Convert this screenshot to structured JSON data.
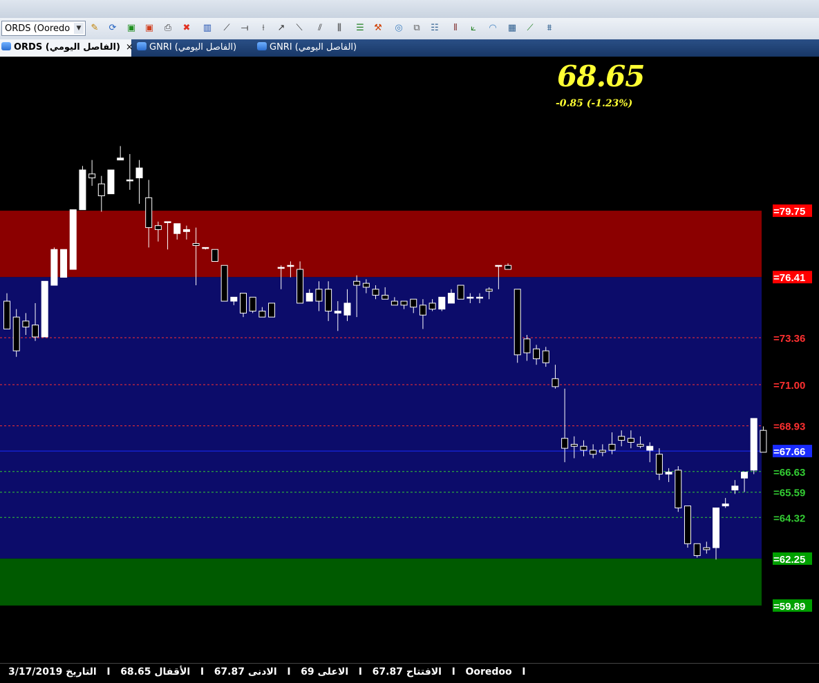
{
  "toolbar": {
    "symbol_value": "ORDS (Ooredo",
    "tools": [
      "magic-wand-icon",
      "refresh-icon",
      "add-chart-icon",
      "remove-chart-icon",
      "print-icon",
      "close-red-icon",
      "bar-chart-icon",
      "trend-tool-icon",
      "horizontal-line-icon",
      "vertical-line-icon",
      "ray-icon",
      "channel-icon",
      "parallel-icon",
      "bars-icon",
      "levels-icon",
      "tools-icon",
      "circle-icon",
      "copy-icon",
      "grid-icon",
      "stripes-icon",
      "fan-icon",
      "arc-icon",
      "table-icon",
      "speed-lines-icon",
      "pitchfork-icon"
    ]
  },
  "tabs": [
    {
      "label": "ORDS (الفاصل اليومي)",
      "close": "×",
      "active": true
    },
    {
      "label": "GNRI (الفاصل اليومي)",
      "active": false
    },
    {
      "label": "GNRI (الفاصل اليومي)",
      "active": false
    }
  ],
  "price": {
    "last": "68.65",
    "change": "-0.85  (-1.23%)"
  },
  "chart_data": {
    "type": "candlestick",
    "ylim": [
      57.0,
      87.5
    ],
    "zones": [
      {
        "from": 76.41,
        "to": 79.75,
        "color": "#8b0000"
      },
      {
        "from": 62.25,
        "to": 76.41,
        "color": "#0c0c6a"
      },
      {
        "from": 59.89,
        "to": 62.25,
        "color": "#005a00"
      }
    ],
    "levels": [
      {
        "value": 79.75,
        "label": "=79.75",
        "color": "#ff0000",
        "style": "box"
      },
      {
        "value": 76.41,
        "label": "=76.41",
        "color": "#ff0000",
        "style": "box"
      },
      {
        "value": 73.36,
        "label": "=73.36",
        "color": "#ff3030",
        "style": "dashed"
      },
      {
        "value": 71.0,
        "label": "=71.00",
        "color": "#ff3030",
        "style": "dashed"
      },
      {
        "value": 68.93,
        "label": "=68.93",
        "color": "#ff3030",
        "style": "dashed"
      },
      {
        "value": 67.66,
        "label": "=67.66",
        "color": "#1a2cff",
        "style": "solid"
      },
      {
        "value": 66.63,
        "label": "=66.63",
        "color": "#33cc33",
        "style": "dashed"
      },
      {
        "value": 65.59,
        "label": "=65.59",
        "color": "#33cc33",
        "style": "dashed"
      },
      {
        "value": 64.32,
        "label": "=64.32",
        "color": "#33cc33",
        "style": "dashed"
      },
      {
        "value": 62.25,
        "label": "=62.25",
        "color": "#00a000",
        "style": "box"
      },
      {
        "value": 59.89,
        "label": "=59.89",
        "color": "#00a000",
        "style": "box"
      }
    ],
    "candles": [
      [
        75.2,
        75.6,
        73.9,
        73.8
      ],
      [
        74.4,
        74.8,
        72.4,
        72.7
      ],
      [
        74.2,
        74.6,
        73.5,
        73.9
      ],
      [
        74.0,
        75.1,
        73.2,
        73.4
      ],
      [
        73.4,
        76.2,
        73.4,
        76.2
      ],
      [
        76.0,
        77.9,
        76.0,
        77.8
      ],
      [
        76.4,
        77.8,
        76.4,
        77.8
      ],
      [
        76.8,
        79.8,
        76.8,
        79.8
      ],
      [
        79.8,
        82.0,
        79.8,
        81.8
      ],
      [
        81.6,
        82.3,
        81.0,
        81.4
      ],
      [
        81.1,
        81.5,
        79.7,
        80.5
      ],
      [
        80.6,
        81.8,
        80.6,
        81.8
      ],
      [
        82.3,
        83.0,
        82.3,
        82.4
      ],
      [
        81.3,
        82.6,
        80.8,
        81.3
      ],
      [
        81.4,
        82.3,
        80.1,
        81.9
      ],
      [
        80.4,
        81.3,
        77.9,
        78.9
      ],
      [
        79.0,
        79.2,
        78.2,
        78.8
      ],
      [
        79.2,
        79.2,
        77.8,
        79.2
      ],
      [
        78.6,
        79.0,
        78.3,
        79.1
      ],
      [
        78.7,
        79.0,
        78.3,
        78.8
      ],
      [
        78.1,
        78.9,
        76.0,
        78.0
      ],
      [
        77.9,
        77.9,
        77.8,
        77.9
      ],
      [
        77.8,
        77.8,
        77.2,
        77.2
      ],
      [
        77.0,
        77.0,
        75.2,
        75.2
      ],
      [
        75.2,
        75.2,
        75.0,
        75.4
      ],
      [
        75.6,
        75.6,
        74.4,
        74.6
      ],
      [
        75.4,
        75.4,
        74.6,
        74.7
      ],
      [
        74.7,
        74.9,
        74.4,
        74.4
      ],
      [
        75.1,
        75.1,
        74.6,
        74.4
      ],
      [
        76.9,
        77.0,
        75.8,
        76.9
      ],
      [
        77.0,
        77.2,
        76.4,
        77.0
      ],
      [
        76.8,
        77.2,
        75.1,
        75.1
      ],
      [
        75.2,
        75.8,
        75.2,
        75.6
      ],
      [
        75.8,
        76.2,
        74.7,
        75.2
      ],
      [
        75.8,
        76.2,
        74.2,
        74.7
      ],
      [
        74.6,
        75.2,
        73.7,
        74.7
      ],
      [
        74.5,
        75.8,
        74.2,
        75.1
      ],
      [
        76.2,
        76.5,
        74.4,
        76.0
      ],
      [
        76.1,
        76.3,
        75.6,
        75.9
      ],
      [
        75.8,
        76.0,
        75.3,
        75.5
      ],
      [
        75.5,
        75.9,
        75.4,
        75.3
      ],
      [
        75.2,
        75.4,
        75.2,
        75.0
      ],
      [
        75.2,
        75.2,
        74.8,
        75.0
      ],
      [
        75.3,
        75.3,
        74.6,
        74.9
      ],
      [
        75.0,
        75.3,
        73.8,
        74.5
      ],
      [
        75.1,
        75.3,
        74.7,
        74.8
      ],
      [
        74.8,
        75.1,
        74.7,
        75.4
      ],
      [
        75.1,
        75.8,
        75.1,
        75.6
      ],
      [
        76.0,
        76.0,
        75.3,
        75.3
      ],
      [
        75.4,
        75.6,
        75.1,
        75.4
      ],
      [
        75.4,
        75.6,
        75.1,
        75.4
      ],
      [
        75.8,
        75.9,
        75.3,
        75.7
      ],
      [
        77.0,
        77.0,
        75.8,
        77.0
      ],
      [
        77.0,
        77.1,
        76.8,
        76.8
      ],
      [
        75.8,
        75.8,
        72.1,
        72.5
      ],
      [
        73.3,
        73.5,
        72.2,
        72.6
      ],
      [
        72.8,
        73.0,
        72.0,
        72.3
      ],
      [
        72.7,
        72.9,
        71.9,
        72.1
      ],
      [
        71.3,
        72.0,
        70.8,
        70.9
      ],
      [
        68.3,
        70.8,
        67.1,
        67.8
      ],
      [
        68.0,
        68.4,
        67.3,
        67.9
      ],
      [
        67.9,
        68.2,
        67.4,
        67.7
      ],
      [
        67.7,
        68.0,
        67.3,
        67.5
      ],
      [
        67.7,
        68.0,
        67.4,
        67.6
      ],
      [
        68.0,
        68.6,
        67.5,
        67.7
      ],
      [
        68.4,
        68.7,
        67.9,
        68.2
      ],
      [
        68.3,
        68.7,
        67.8,
        68.1
      ],
      [
        68.0,
        68.4,
        67.8,
        67.9
      ],
      [
        67.7,
        68.1,
        67.1,
        67.9
      ],
      [
        67.5,
        67.8,
        66.2,
        66.5
      ],
      [
        66.5,
        66.8,
        66.1,
        66.6
      ],
      [
        66.7,
        66.9,
        64.6,
        64.8
      ],
      [
        64.9,
        64.9,
        62.8,
        63.0
      ],
      [
        63.0,
        63.0,
        62.3,
        62.4
      ],
      [
        62.8,
        63.1,
        62.5,
        62.7
      ],
      [
        62.8,
        64.8,
        62.2,
        64.8
      ],
      [
        64.9,
        65.3,
        64.8,
        65.0
      ],
      [
        65.7,
        66.2,
        65.5,
        65.9
      ],
      [
        66.3,
        66.5,
        65.6,
        66.6
      ],
      [
        66.7,
        69.3,
        66.5,
        69.3
      ],
      [
        68.7,
        68.9,
        67.8,
        67.6
      ]
    ]
  },
  "status": {
    "text": "3/17/2019 التاريخ   I   68.65 الأقفال   I   67.87 الادنى   I   69 الاعلى   I   67.87 الافتتاح   I   Ooredoo   I"
  }
}
